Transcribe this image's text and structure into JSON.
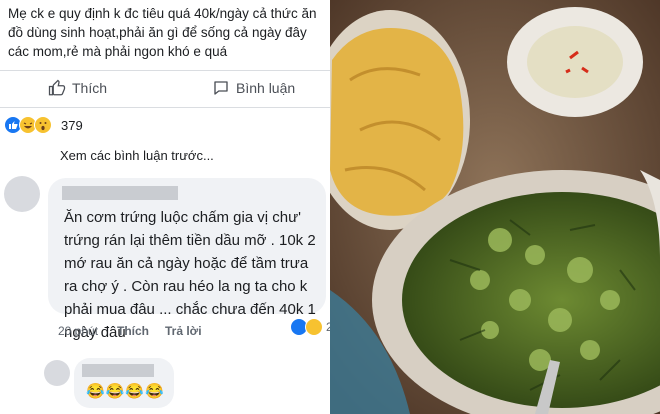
{
  "post": {
    "text": "Mẹ ck e quy định k đc tiêu quá 40k/ngày cả thức ăn đồ dùng sinh hoạt,phải ăn gì để sống cả ngày đây các mom,rẻ mà phải ngon khó e quá"
  },
  "actions": {
    "like_label": "Thích",
    "comment_label": "Bình luận"
  },
  "reactions": {
    "count": "379"
  },
  "comments": {
    "view_previous": "Xem các bình luận trước...",
    "first": {
      "text": "Ăn cơm trứng luộc chấm gia vị chư' trứng rán lại thêm tiền dầu mỡ . 10k 2 mớ rau ăn cả ngày hoặc để tầm trưa ra chợ ý . Còn rau héo la ng ta cho k phải mua đâu ... chắc chưa đến 40k 1 ngày đâu",
      "time": "20 phút",
      "like_label": "Thích",
      "reply_label": "Trả lời",
      "reaction_count": "2"
    },
    "second": {
      "emojis": "😂😂😂😂"
    }
  },
  "colors": {
    "facebook_blue": "#1877f2",
    "comment_bg": "#f0f2f5"
  },
  "photo": {
    "description_icons": [
      "omelette",
      "soup-bowl",
      "dipping-sauce-bowl"
    ]
  }
}
